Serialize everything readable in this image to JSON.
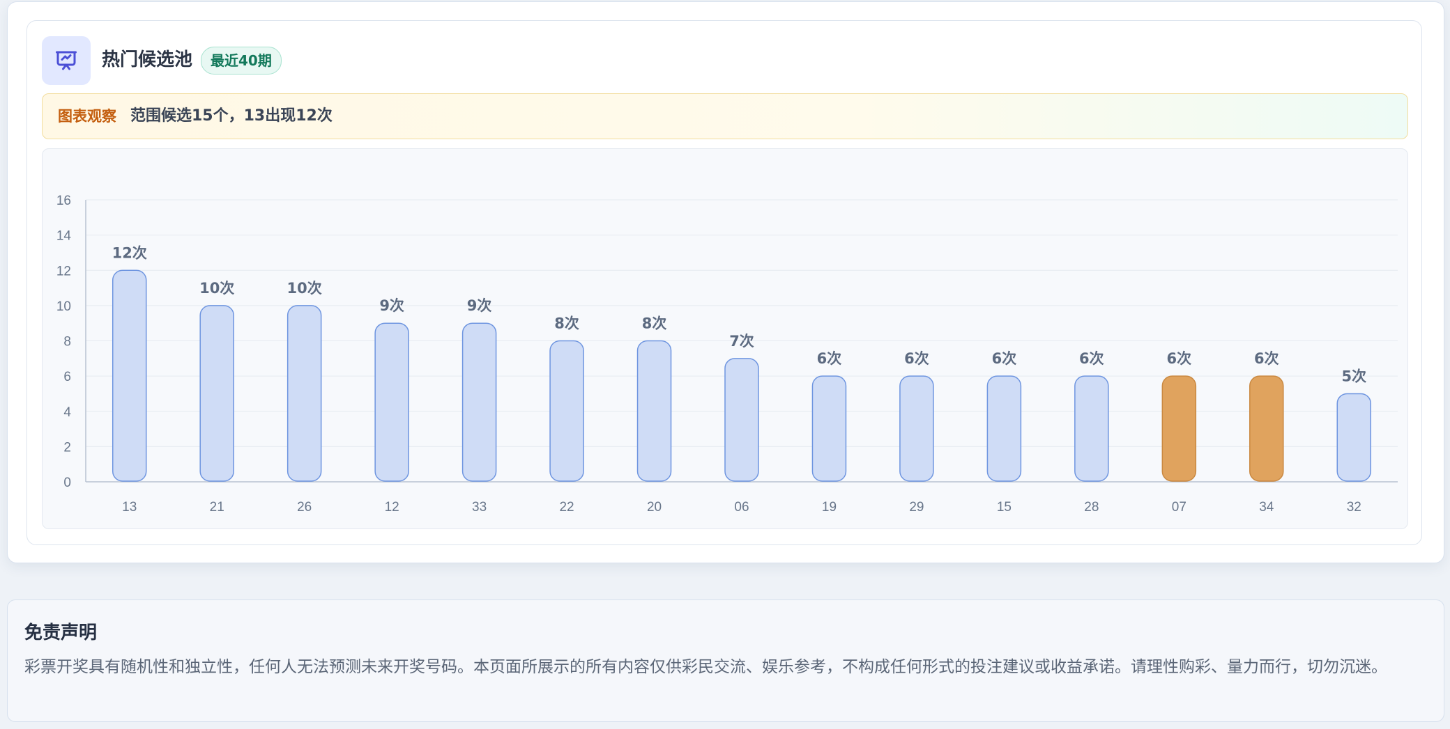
{
  "card": {
    "icon": "presentation-chart-icon",
    "title": "热门候选池",
    "badge": "最近40期"
  },
  "insight": {
    "tag": "图表观察",
    "text": "范围候选15个，13出现12次"
  },
  "colors": {
    "bar_fill": "#cfdcf6",
    "bar_stroke": "#6e95e0",
    "bar_highlight_fill": "#e0a35e",
    "bar_highlight_stroke": "#c98840",
    "label_color": "#5c6a80",
    "axis_color": "#b9c3d1"
  },
  "chart_data": {
    "type": "bar",
    "categories": [
      "13",
      "21",
      "26",
      "12",
      "33",
      "22",
      "20",
      "06",
      "19",
      "29",
      "15",
      "28",
      "07",
      "34",
      "32"
    ],
    "values": [
      12,
      10,
      10,
      9,
      9,
      8,
      8,
      7,
      6,
      6,
      6,
      6,
      6,
      6,
      5
    ],
    "value_labels": [
      "12次",
      "10次",
      "10次",
      "9次",
      "9次",
      "8次",
      "8次",
      "7次",
      "6次",
      "6次",
      "6次",
      "6次",
      "6次",
      "6次",
      "5次"
    ],
    "highlighted": [
      "07",
      "34"
    ],
    "ylim": [
      0,
      16
    ],
    "yticks": [
      0,
      2,
      4,
      6,
      8,
      10,
      12,
      14,
      16
    ],
    "grid": true,
    "xlabel": "",
    "ylabel": ""
  },
  "disclaimer": {
    "title": "免责声明",
    "body": "彩票开奖具有随机性和独立性，任何人无法预测未来开奖号码。本页面所展示的所有内容仅供彩民交流、娱乐参考，不构成任何形式的投注建议或收益承诺。请理性购彩、量力而行，切勿沉迷。"
  }
}
